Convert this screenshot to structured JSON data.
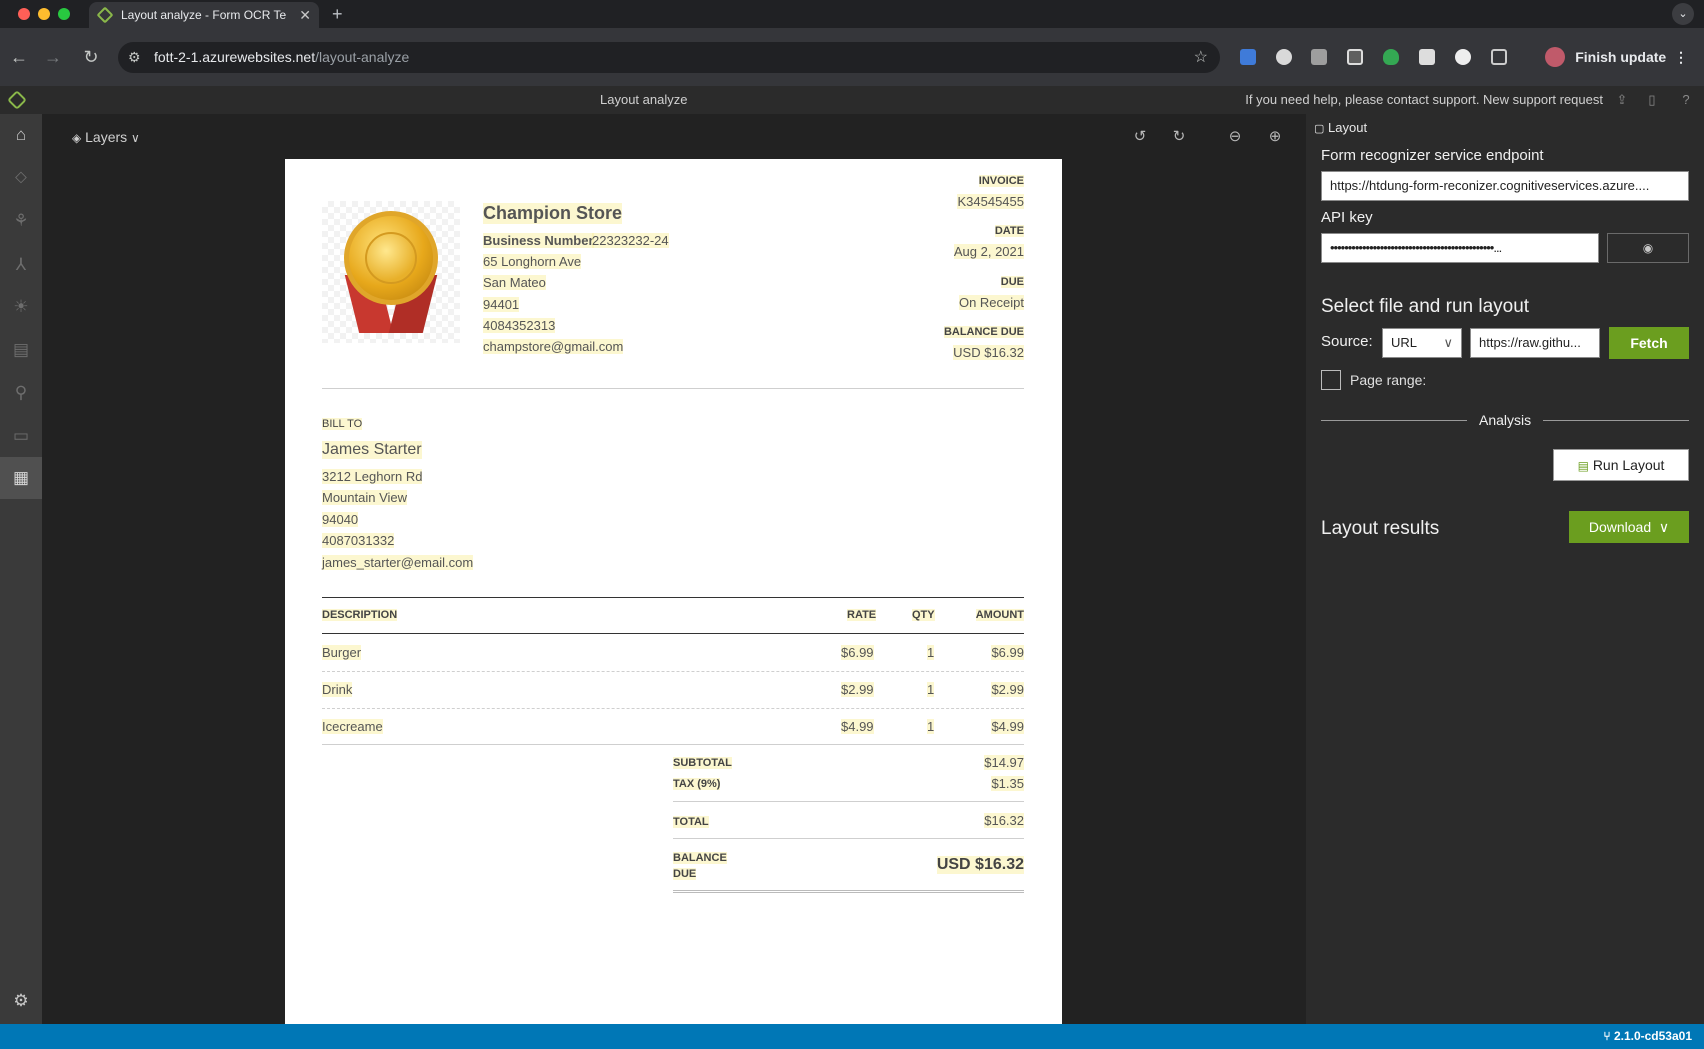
{
  "browser": {
    "tab_title": "Layout analyze - Form OCR Te",
    "url_domain": "fott-2-1.azurewebsites.net",
    "url_path": "/layout-analyze",
    "finish_update": "Finish update"
  },
  "app": {
    "title": "Layout analyze",
    "help_text": "If you need help, please contact support. New support request"
  },
  "canvas": {
    "layers_label": "Layers"
  },
  "invoice": {
    "store_name": "Champion Store",
    "business_number_label": "Business Number",
    "business_number": "22323232-24",
    "address1": "65 Longhorn Ave",
    "city": "San Mateo",
    "zip": "94401",
    "phone": "4084352313",
    "email": "champstore@gmail.com",
    "invoice_label": "INVOICE",
    "invoice_no": "K34545455",
    "date_label": "DATE",
    "date": "Aug 2, 2021",
    "due_label": "DUE",
    "due": "On Receipt",
    "balance_due_label": "BALANCE DUE",
    "balance_due": "USD $16.32",
    "bill_to_label": "BILL TO",
    "customer_name": "James Starter",
    "customer_address": "3212 Leghorn Rd",
    "customer_city": "Mountain View",
    "customer_zip": "94040",
    "customer_phone": "4087031332",
    "customer_email": "james_starter@email.com",
    "headers": {
      "description": "DESCRIPTION",
      "rate": "RATE",
      "qty": "QTY",
      "amount": "AMOUNT"
    },
    "rows": [
      {
        "description": "Burger",
        "rate": "$6.99",
        "qty": "1",
        "amount": "$6.99"
      },
      {
        "description": "Drink",
        "rate": "$2.99",
        "qty": "1",
        "amount": "$2.99"
      },
      {
        "description": "Icecreame",
        "rate": "$4.99",
        "qty": "1",
        "amount": "$4.99"
      }
    ],
    "subtotal_label": "SUBTOTAL",
    "subtotal": "$14.97",
    "tax_label": "TAX (9%)",
    "tax": "$1.35",
    "total_label": "TOTAL",
    "total": "$16.32",
    "balance_label_1": "BALANCE",
    "balance_label_2": "DUE",
    "balance": "USD $16.32"
  },
  "panel": {
    "header": "Layout",
    "endpoint_label": "Form recognizer service endpoint",
    "endpoint_value": "https://htdung-form-reconizer.cognitiveservices.azure....",
    "api_key_label": "API key",
    "api_key_value": "••••••••••••••••••••••••••••••••••••••••••••••...",
    "select_title": "Select file and run layout",
    "source_label": "Source:",
    "source_value": "URL",
    "url_value": "https://raw.githu...",
    "fetch_label": "Fetch",
    "page_range_label": "Page range:",
    "analysis_label": "Analysis",
    "run_layout_label": "Run Layout",
    "results_title": "Layout results",
    "download_label": "Download"
  },
  "status": {
    "version": "2.1.0-cd53a01"
  }
}
